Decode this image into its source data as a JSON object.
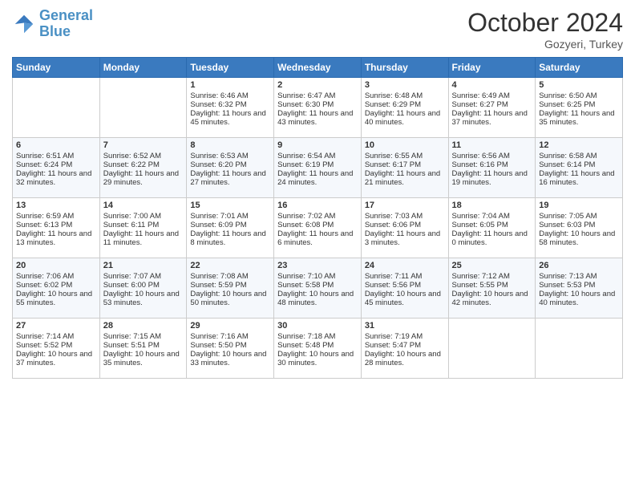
{
  "header": {
    "logo_line1": "General",
    "logo_line2": "Blue",
    "month": "October 2024",
    "location": "Gozyeri, Turkey"
  },
  "days_of_week": [
    "Sunday",
    "Monday",
    "Tuesday",
    "Wednesday",
    "Thursday",
    "Friday",
    "Saturday"
  ],
  "weeks": [
    [
      {
        "day": "",
        "sunrise": "",
        "sunset": "",
        "daylight": ""
      },
      {
        "day": "",
        "sunrise": "",
        "sunset": "",
        "daylight": ""
      },
      {
        "day": "1",
        "sunrise": "Sunrise: 6:46 AM",
        "sunset": "Sunset: 6:32 PM",
        "daylight": "Daylight: 11 hours and 45 minutes."
      },
      {
        "day": "2",
        "sunrise": "Sunrise: 6:47 AM",
        "sunset": "Sunset: 6:30 PM",
        "daylight": "Daylight: 11 hours and 43 minutes."
      },
      {
        "day": "3",
        "sunrise": "Sunrise: 6:48 AM",
        "sunset": "Sunset: 6:29 PM",
        "daylight": "Daylight: 11 hours and 40 minutes."
      },
      {
        "day": "4",
        "sunrise": "Sunrise: 6:49 AM",
        "sunset": "Sunset: 6:27 PM",
        "daylight": "Daylight: 11 hours and 37 minutes."
      },
      {
        "day": "5",
        "sunrise": "Sunrise: 6:50 AM",
        "sunset": "Sunset: 6:25 PM",
        "daylight": "Daylight: 11 hours and 35 minutes."
      }
    ],
    [
      {
        "day": "6",
        "sunrise": "Sunrise: 6:51 AM",
        "sunset": "Sunset: 6:24 PM",
        "daylight": "Daylight: 11 hours and 32 minutes."
      },
      {
        "day": "7",
        "sunrise": "Sunrise: 6:52 AM",
        "sunset": "Sunset: 6:22 PM",
        "daylight": "Daylight: 11 hours and 29 minutes."
      },
      {
        "day": "8",
        "sunrise": "Sunrise: 6:53 AM",
        "sunset": "Sunset: 6:20 PM",
        "daylight": "Daylight: 11 hours and 27 minutes."
      },
      {
        "day": "9",
        "sunrise": "Sunrise: 6:54 AM",
        "sunset": "Sunset: 6:19 PM",
        "daylight": "Daylight: 11 hours and 24 minutes."
      },
      {
        "day": "10",
        "sunrise": "Sunrise: 6:55 AM",
        "sunset": "Sunset: 6:17 PM",
        "daylight": "Daylight: 11 hours and 21 minutes."
      },
      {
        "day": "11",
        "sunrise": "Sunrise: 6:56 AM",
        "sunset": "Sunset: 6:16 PM",
        "daylight": "Daylight: 11 hours and 19 minutes."
      },
      {
        "day": "12",
        "sunrise": "Sunrise: 6:58 AM",
        "sunset": "Sunset: 6:14 PM",
        "daylight": "Daylight: 11 hours and 16 minutes."
      }
    ],
    [
      {
        "day": "13",
        "sunrise": "Sunrise: 6:59 AM",
        "sunset": "Sunset: 6:13 PM",
        "daylight": "Daylight: 11 hours and 13 minutes."
      },
      {
        "day": "14",
        "sunrise": "Sunrise: 7:00 AM",
        "sunset": "Sunset: 6:11 PM",
        "daylight": "Daylight: 11 hours and 11 minutes."
      },
      {
        "day": "15",
        "sunrise": "Sunrise: 7:01 AM",
        "sunset": "Sunset: 6:09 PM",
        "daylight": "Daylight: 11 hours and 8 minutes."
      },
      {
        "day": "16",
        "sunrise": "Sunrise: 7:02 AM",
        "sunset": "Sunset: 6:08 PM",
        "daylight": "Daylight: 11 hours and 6 minutes."
      },
      {
        "day": "17",
        "sunrise": "Sunrise: 7:03 AM",
        "sunset": "Sunset: 6:06 PM",
        "daylight": "Daylight: 11 hours and 3 minutes."
      },
      {
        "day": "18",
        "sunrise": "Sunrise: 7:04 AM",
        "sunset": "Sunset: 6:05 PM",
        "daylight": "Daylight: 11 hours and 0 minutes."
      },
      {
        "day": "19",
        "sunrise": "Sunrise: 7:05 AM",
        "sunset": "Sunset: 6:03 PM",
        "daylight": "Daylight: 10 hours and 58 minutes."
      }
    ],
    [
      {
        "day": "20",
        "sunrise": "Sunrise: 7:06 AM",
        "sunset": "Sunset: 6:02 PM",
        "daylight": "Daylight: 10 hours and 55 minutes."
      },
      {
        "day": "21",
        "sunrise": "Sunrise: 7:07 AM",
        "sunset": "Sunset: 6:00 PM",
        "daylight": "Daylight: 10 hours and 53 minutes."
      },
      {
        "day": "22",
        "sunrise": "Sunrise: 7:08 AM",
        "sunset": "Sunset: 5:59 PM",
        "daylight": "Daylight: 10 hours and 50 minutes."
      },
      {
        "day": "23",
        "sunrise": "Sunrise: 7:10 AM",
        "sunset": "Sunset: 5:58 PM",
        "daylight": "Daylight: 10 hours and 48 minutes."
      },
      {
        "day": "24",
        "sunrise": "Sunrise: 7:11 AM",
        "sunset": "Sunset: 5:56 PM",
        "daylight": "Daylight: 10 hours and 45 minutes."
      },
      {
        "day": "25",
        "sunrise": "Sunrise: 7:12 AM",
        "sunset": "Sunset: 5:55 PM",
        "daylight": "Daylight: 10 hours and 42 minutes."
      },
      {
        "day": "26",
        "sunrise": "Sunrise: 7:13 AM",
        "sunset": "Sunset: 5:53 PM",
        "daylight": "Daylight: 10 hours and 40 minutes."
      }
    ],
    [
      {
        "day": "27",
        "sunrise": "Sunrise: 7:14 AM",
        "sunset": "Sunset: 5:52 PM",
        "daylight": "Daylight: 10 hours and 37 minutes."
      },
      {
        "day": "28",
        "sunrise": "Sunrise: 7:15 AM",
        "sunset": "Sunset: 5:51 PM",
        "daylight": "Daylight: 10 hours and 35 minutes."
      },
      {
        "day": "29",
        "sunrise": "Sunrise: 7:16 AM",
        "sunset": "Sunset: 5:50 PM",
        "daylight": "Daylight: 10 hours and 33 minutes."
      },
      {
        "day": "30",
        "sunrise": "Sunrise: 7:18 AM",
        "sunset": "Sunset: 5:48 PM",
        "daylight": "Daylight: 10 hours and 30 minutes."
      },
      {
        "day": "31",
        "sunrise": "Sunrise: 7:19 AM",
        "sunset": "Sunset: 5:47 PM",
        "daylight": "Daylight: 10 hours and 28 minutes."
      },
      {
        "day": "",
        "sunrise": "",
        "sunset": "",
        "daylight": ""
      },
      {
        "day": "",
        "sunrise": "",
        "sunset": "",
        "daylight": ""
      }
    ]
  ]
}
